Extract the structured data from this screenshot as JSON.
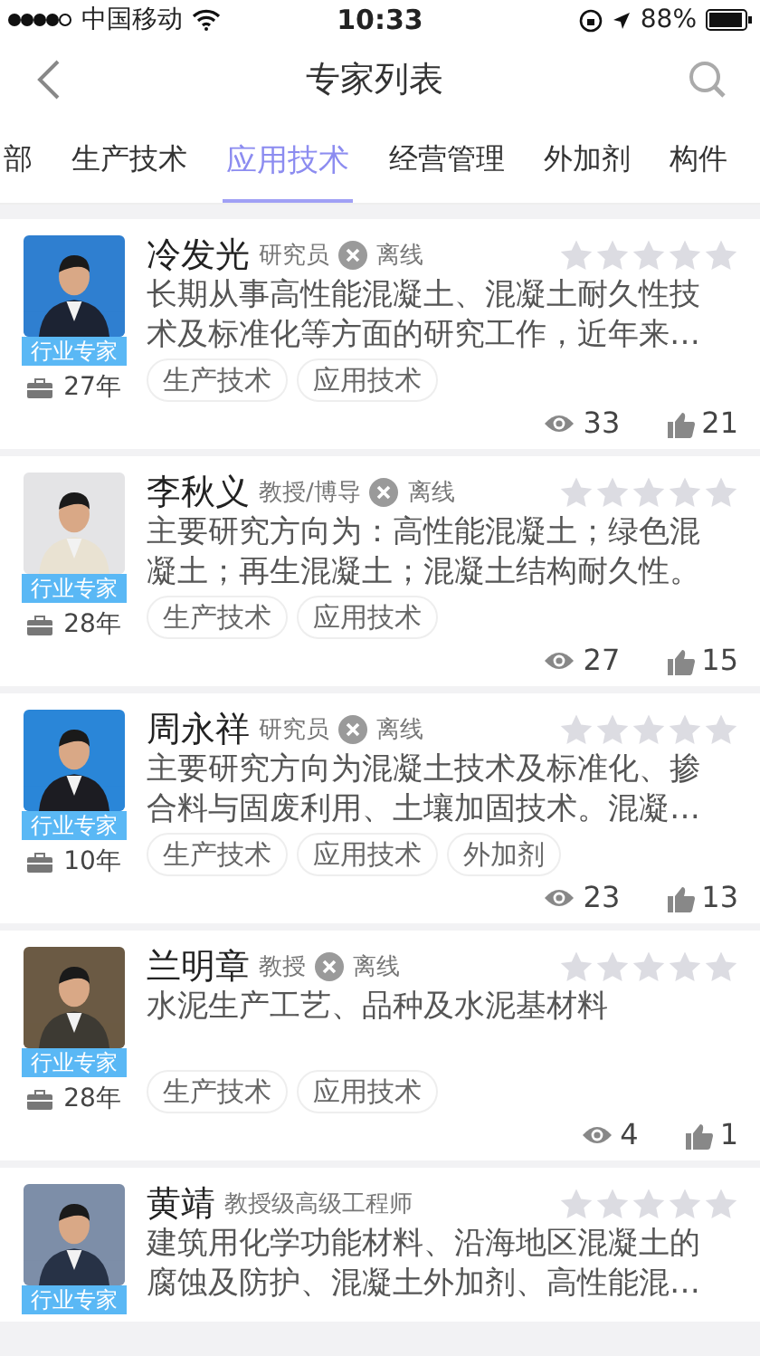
{
  "status_bar": {
    "carrier": "中国移动",
    "time": "10:33",
    "battery": "88%"
  },
  "nav": {
    "title": "专家列表"
  },
  "tabs": [
    {
      "label": "部",
      "selected": false
    },
    {
      "label": "生产技术",
      "selected": false
    },
    {
      "label": "应用技术",
      "selected": true
    },
    {
      "label": "经营管理",
      "selected": false
    },
    {
      "label": "外加剂",
      "selected": false
    },
    {
      "label": "构件",
      "selected": false
    }
  ],
  "experts": [
    {
      "name": "冷发光",
      "title": "研究员",
      "status": "离线",
      "online": false,
      "badge": "行业专家",
      "years": "27年",
      "stars": 0,
      "description": "长期从事高性能混凝土、混凝土耐久性技术及标准化等方面的研究工作，近年来…",
      "tags": [
        "生产技术",
        "应用技术"
      ],
      "views": "33",
      "likes": "21"
    },
    {
      "name": "李秋义",
      "title": "教授/博导",
      "status": "离线",
      "online": false,
      "badge": "行业专家",
      "years": "28年",
      "stars": 0,
      "description": "主要研究方向为：高性能混凝土；绿色混凝土；再生混凝土；混凝土结构耐久性。",
      "tags": [
        "生产技术",
        "应用技术"
      ],
      "views": "27",
      "likes": "15"
    },
    {
      "name": "周永祥",
      "title": "研究员",
      "status": "离线",
      "online": false,
      "badge": "行业专家",
      "years": "10年",
      "stars": 0,
      "description": "主要研究方向为混凝土技术及标准化、掺合料与固废利用、土壤加固技术。混凝…",
      "tags": [
        "生产技术",
        "应用技术",
        "外加剂"
      ],
      "views": "23",
      "likes": "13"
    },
    {
      "name": "兰明章",
      "title": "教授",
      "status": "离线",
      "online": false,
      "badge": "行业专家",
      "years": "28年",
      "stars": 0,
      "description": "水泥生产工艺、品种及水泥基材料",
      "tags": [
        "生产技术",
        "应用技术"
      ],
      "views": "4",
      "likes": "1"
    },
    {
      "name": "黄靖",
      "title": "教授级高级工程师",
      "badge": "行业专家",
      "stars": 0,
      "description": "建筑用化学功能材料、沿海地区混凝土的腐蚀及防护、混凝土外加剂、高性能混…"
    }
  ]
}
